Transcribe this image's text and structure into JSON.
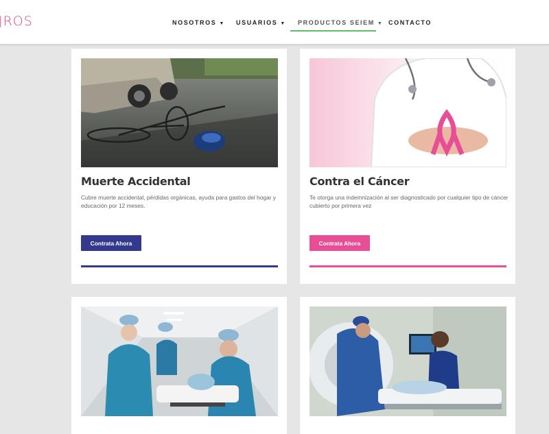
{
  "header": {
    "logo_text": "JROS",
    "nav": [
      {
        "label": "NOSOTROS",
        "caret": "▼"
      },
      {
        "label": "USUARIOS",
        "caret": "▼"
      },
      {
        "label": "PRODUCTOS SEIEM",
        "caret": "▼"
      },
      {
        "label": "CONTACTO",
        "caret": ""
      }
    ],
    "accent_color": "#5cbd6b"
  },
  "cards": [
    {
      "title": "Muerte Accidental",
      "description": "Cubre muerte accidental, pérdidas orgánicas, ayuda para gastos del hogar y educación por 12 meses.",
      "button_label": "Contrata Ahora",
      "accent_color": "#333a8e",
      "image": "bicycle-accident-photo"
    },
    {
      "title": "Contra el Cáncer",
      "description": "Te otorga una indemnización al ser diagnosticado por cualquier tipo de cáncer cubierto por primera vez",
      "button_label": "Contrata Ahora",
      "accent_color": "#e84e96",
      "image": "doctor-pink-ribbon-photo"
    },
    {
      "image": "hospital-stretcher-photo"
    },
    {
      "image": "ct-scan-photo"
    }
  ]
}
